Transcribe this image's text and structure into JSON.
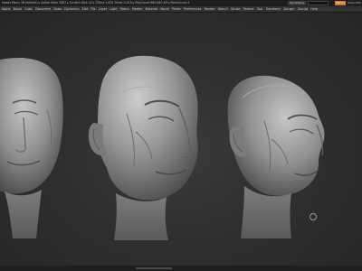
{
  "titlebar": {
    "title": "Heads Menu 3B (default) ▸ Active Mem 3087 ▸ Scratch Disk 42 ▸ ZTime 1.652 Timer 0.015 ▸ PolyCount 660.640 KP ▸ MeshCount 4",
    "quicksave": "QuickSave",
    "search_placeholder": "",
    "orange_button": "Menus",
    "right_label": "DefaultZS"
  },
  "menubar": {
    "items": [
      "Alpha",
      "Brush",
      "Color",
      "Document",
      "Draw",
      "Dynamics",
      "Edit",
      "File",
      "Layer",
      "Light",
      "Macro",
      "Marker",
      "Material",
      "Movie",
      "Picker",
      "Preferences",
      "Render",
      "Stencil",
      "Stroke",
      "Texture",
      "Tool",
      "Transform",
      "Zplugin",
      "Zscript",
      "Help"
    ]
  },
  "viewport": {
    "model_color": "#9a9a9a",
    "background": "#2f2f2f"
  }
}
